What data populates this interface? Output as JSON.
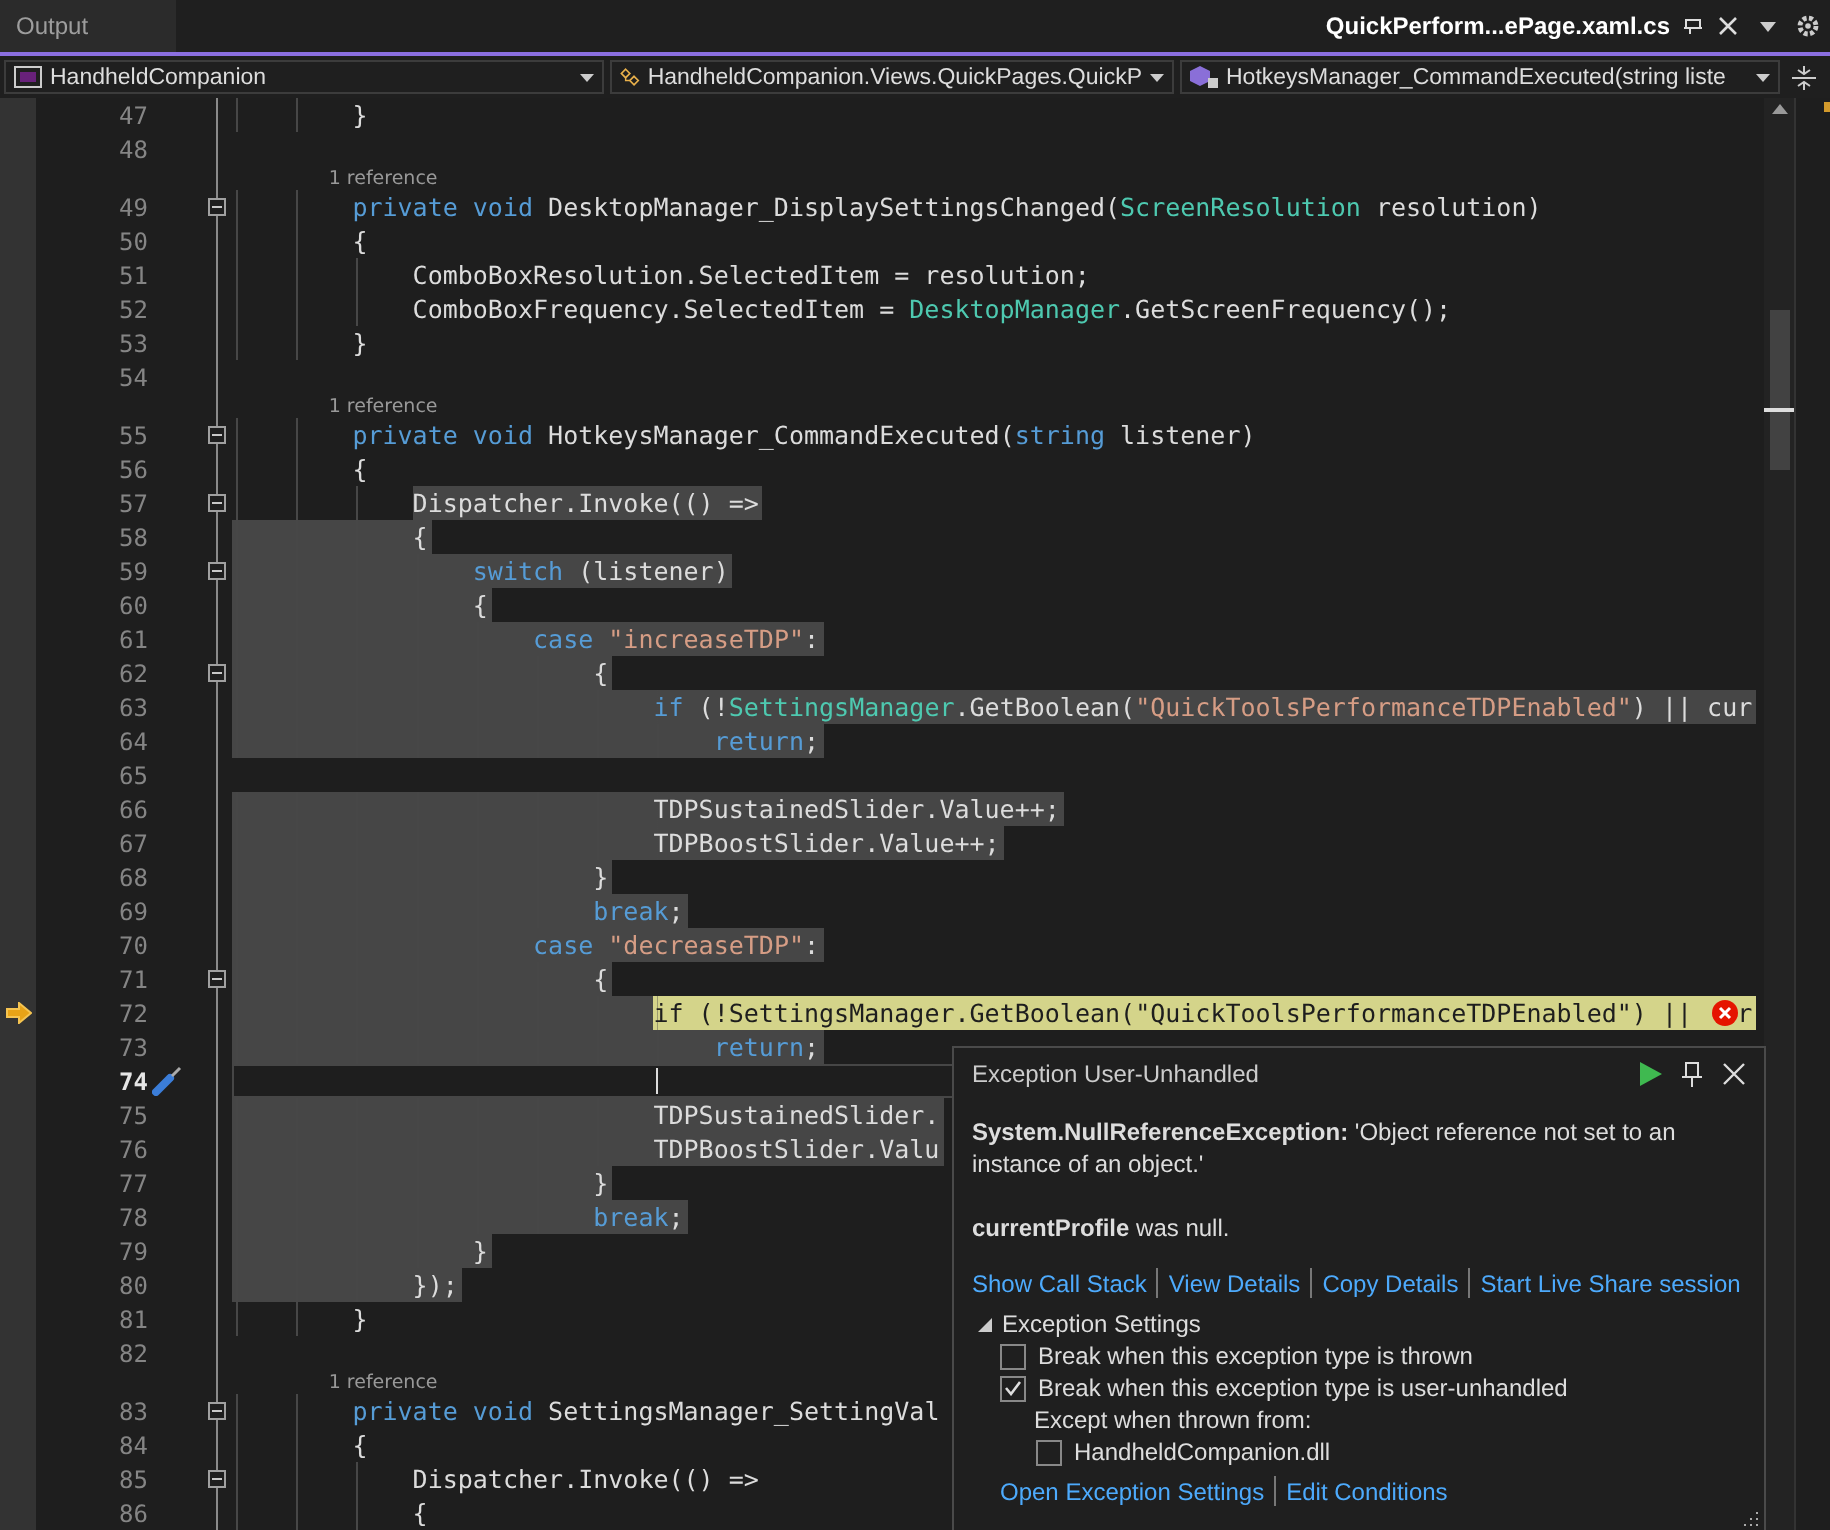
{
  "tabs": [
    {
      "label": "Output",
      "selected": false
    },
    {
      "label": "QuickPerform...ePage.xaml.cs",
      "selected": true
    }
  ],
  "nav": [
    {
      "kind": "project",
      "label": "HandheldCompanion"
    },
    {
      "kind": "class",
      "label": "HandheldCompanion.Views.QuickPages.QuickP"
    },
    {
      "kind": "method",
      "label": "HotkeysManager_CommandExecuted(string liste"
    }
  ],
  "lines": [
    {
      "n": "47",
      "fold": false,
      "highlighted": false,
      "indent_highlighted": false,
      "current": false,
      "cursor": false,
      "tokens": [
        {
          "kind": "id",
          "t": "        }"
        }
      ]
    },
    {
      "n": "48",
      "fold": false,
      "current": false,
      "cursor": false
    },
    {
      "n": "49",
      "lens": "1 reference",
      "fold": true,
      "highlighted": false,
      "indent_highlighted": false,
      "current": false,
      "cursor": false,
      "tokens": [
        {
          "kind": "kw",
          "t": "        private void "
        },
        {
          "kind": "id",
          "t": "DesktopManager_DisplaySettingsChanged("
        },
        {
          "kind": "type",
          "t": "ScreenResolution"
        },
        {
          "kind": "id",
          "t": " resolution)"
        }
      ]
    },
    {
      "n": "50",
      "fold": false,
      "highlighted": false,
      "indent_highlighted": false,
      "current": false,
      "cursor": false,
      "tokens": [
        {
          "kind": "id",
          "t": "        {"
        }
      ]
    },
    {
      "n": "51",
      "fold": false,
      "highlighted": false,
      "indent_highlighted": false,
      "current": false,
      "cursor": false,
      "tokens": [
        {
          "kind": "id",
          "t": "            ComboBoxResolution.SelectedItem = resolution;"
        }
      ]
    },
    {
      "n": "52",
      "fold": false,
      "highlighted": false,
      "indent_highlighted": false,
      "current": false,
      "cursor": false,
      "tokens": [
        {
          "kind": "id",
          "t": "            ComboBoxFrequency.SelectedItem = "
        },
        {
          "kind": "type",
          "t": "DesktopManager"
        },
        {
          "kind": "id",
          "t": ".GetScreenFrequency();"
        }
      ]
    },
    {
      "n": "53",
      "fold": false,
      "highlighted": false,
      "indent_highlighted": false,
      "current": false,
      "cursor": false,
      "tokens": [
        {
          "kind": "id",
          "t": "        }"
        }
      ]
    },
    {
      "n": "54",
      "fold": false,
      "current": false,
      "cursor": false
    },
    {
      "n": "55",
      "lens": "1 reference",
      "fold": true,
      "highlighted": false,
      "indent_highlighted": false,
      "current": false,
      "cursor": false,
      "tokens": [
        {
          "kind": "kw",
          "t": "        private void "
        },
        {
          "kind": "id",
          "t": "HotkeysManager_CommandExecuted("
        },
        {
          "kind": "kw",
          "t": "string"
        },
        {
          "kind": "id",
          "t": " listener)"
        }
      ]
    },
    {
      "n": "56",
      "fold": false,
      "highlighted": false,
      "indent_highlighted": false,
      "current": false,
      "cursor": false,
      "tokens": [
        {
          "kind": "id",
          "t": "        {"
        }
      ]
    },
    {
      "n": "57",
      "fold": true,
      "highlighted": true,
      "indent_highlighted": false,
      "current": false,
      "cursor": false,
      "tokens": [
        {
          "kind": "id",
          "t": "            Dispatcher.Invoke(() =>"
        }
      ]
    },
    {
      "n": "58",
      "fold": false,
      "highlighted": true,
      "indent_highlighted": true,
      "current": false,
      "cursor": false,
      "tokens": [
        {
          "kind": "id",
          "t": "            {"
        }
      ]
    },
    {
      "n": "59",
      "fold": true,
      "highlighted": true,
      "indent_highlighted": true,
      "current": false,
      "cursor": false,
      "tokens": [
        {
          "kind": "kw",
          "t": "                switch"
        },
        {
          "kind": "id",
          "t": " (listener)"
        }
      ]
    },
    {
      "n": "60",
      "fold": false,
      "highlighted": true,
      "indent_highlighted": true,
      "current": false,
      "cursor": false,
      "tokens": [
        {
          "kind": "id",
          "t": "                {"
        }
      ]
    },
    {
      "n": "61",
      "fold": false,
      "highlighted": true,
      "indent_highlighted": true,
      "current": false,
      "cursor": false,
      "tokens": [
        {
          "kind": "kw",
          "t": "                    case "
        },
        {
          "kind": "str",
          "t": "\"increaseTDP\""
        },
        {
          "kind": "id",
          "t": ":"
        }
      ]
    },
    {
      "n": "62",
      "fold": true,
      "highlighted": true,
      "indent_highlighted": true,
      "current": false,
      "cursor": false,
      "tokens": [
        {
          "kind": "id",
          "t": "                        {"
        }
      ]
    },
    {
      "n": "63",
      "fold": false,
      "highlighted": true,
      "indent_highlighted": true,
      "current": false,
      "cursor": false,
      "tokens": [
        {
          "kind": "kw",
          "t": "                            if"
        },
        {
          "kind": "id",
          "t": " (!"
        },
        {
          "kind": "type",
          "t": "SettingsManager"
        },
        {
          "kind": "id",
          "t": ".GetBoolean("
        },
        {
          "kind": "str",
          "t": "\"QuickToolsPerformanceTDPEnabled\""
        },
        {
          "kind": "id",
          "t": ") || cur"
        }
      ]
    },
    {
      "n": "64",
      "fold": false,
      "highlighted": true,
      "indent_highlighted": true,
      "current": false,
      "cursor": false,
      "tokens": [
        {
          "kind": "kw",
          "t": "                                return"
        },
        {
          "kind": "id",
          "t": ";"
        }
      ]
    },
    {
      "n": "65",
      "fold": false,
      "current": false,
      "cursor": false
    },
    {
      "n": "66",
      "fold": false,
      "highlighted": true,
      "indent_highlighted": true,
      "current": false,
      "cursor": false,
      "tokens": [
        {
          "kind": "id",
          "t": "                            TDPSustainedSlider.Value++;"
        }
      ]
    },
    {
      "n": "67",
      "fold": false,
      "highlighted": true,
      "indent_highlighted": true,
      "current": false,
      "cursor": false,
      "tokens": [
        {
          "kind": "id",
          "t": "                            TDPBoostSlider.Value++;"
        }
      ]
    },
    {
      "n": "68",
      "fold": false,
      "highlighted": true,
      "indent_highlighted": true,
      "current": false,
      "cursor": false,
      "tokens": [
        {
          "kind": "id",
          "t": "                        }"
        }
      ]
    },
    {
      "n": "69",
      "fold": false,
      "highlighted": true,
      "indent_highlighted": true,
      "current": false,
      "cursor": false,
      "tokens": [
        {
          "kind": "kw",
          "t": "                        break"
        },
        {
          "kind": "id",
          "t": ";"
        }
      ]
    },
    {
      "n": "70",
      "fold": false,
      "highlighted": true,
      "indent_highlighted": true,
      "current": false,
      "cursor": false,
      "tokens": [
        {
          "kind": "kw",
          "t": "                    case "
        },
        {
          "kind": "str",
          "t": "\"decreaseTDP\""
        },
        {
          "kind": "id",
          "t": ":"
        }
      ]
    },
    {
      "n": "71",
      "fold": true,
      "highlighted": true,
      "indent_highlighted": true,
      "current": false,
      "cursor": false,
      "tokens": [
        {
          "kind": "id",
          "t": "                        {"
        }
      ]
    },
    {
      "n": "72",
      "fold": false,
      "indent_highlighted": true,
      "current": true,
      "cursor": false,
      "tokens": [
        {
          "kind": "kw",
          "t": "                            if"
        },
        {
          "kind": "id",
          "t": " (!"
        },
        {
          "kind": "type",
          "t": "SettingsManager"
        },
        {
          "kind": "id",
          "t": ".GetBoolean("
        },
        {
          "kind": "str",
          "t": "\"QuickToolsPerformanceTDPEnabled\""
        },
        {
          "kind": "id",
          "t": ") || "
        },
        {
          "kind": "error"
        },
        {
          "kind": "id",
          "t": "r"
        }
      ]
    },
    {
      "n": "73",
      "fold": false,
      "highlighted": true,
      "indent_highlighted": true,
      "current": false,
      "cursor": false,
      "tokens": [
        {
          "kind": "kw",
          "t": "                                return"
        },
        {
          "kind": "id",
          "t": ";"
        }
      ]
    },
    {
      "n": "74",
      "fold": false,
      "current": false,
      "cursor": true
    },
    {
      "n": "75",
      "fold": false,
      "highlighted": true,
      "indent_highlighted": true,
      "current": false,
      "cursor": false,
      "tokens": [
        {
          "kind": "id",
          "t": "                            TDPSustainedSlider."
        }
      ]
    },
    {
      "n": "76",
      "fold": false,
      "highlighted": true,
      "indent_highlighted": true,
      "current": false,
      "cursor": false,
      "tokens": [
        {
          "kind": "id",
          "t": "                            TDPBoostSlider.Valu"
        }
      ]
    },
    {
      "n": "77",
      "fold": false,
      "highlighted": true,
      "indent_highlighted": true,
      "current": false,
      "cursor": false,
      "tokens": [
        {
          "kind": "id",
          "t": "                        }"
        }
      ]
    },
    {
      "n": "78",
      "fold": false,
      "highlighted": true,
      "indent_highlighted": true,
      "current": false,
      "cursor": false,
      "tokens": [
        {
          "kind": "kw",
          "t": "                        break"
        },
        {
          "kind": "id",
          "t": ";"
        }
      ]
    },
    {
      "n": "79",
      "fold": false,
      "highlighted": true,
      "indent_highlighted": true,
      "current": false,
      "cursor": false,
      "tokens": [
        {
          "kind": "id",
          "t": "                }"
        }
      ]
    },
    {
      "n": "80",
      "fold": false,
      "highlighted": true,
      "indent_highlighted": true,
      "current": false,
      "cursor": false,
      "tokens": [
        {
          "kind": "id",
          "t": "            });"
        }
      ]
    },
    {
      "n": "81",
      "fold": false,
      "highlighted": false,
      "indent_highlighted": false,
      "current": false,
      "cursor": false,
      "tokens": [
        {
          "kind": "id",
          "t": "        }"
        }
      ]
    },
    {
      "n": "82",
      "fold": false,
      "current": false,
      "cursor": false
    },
    {
      "n": "83",
      "lens": "1 reference",
      "fold": true,
      "highlighted": false,
      "indent_highlighted": false,
      "current": false,
      "cursor": false,
      "tokens": [
        {
          "kind": "kw",
          "t": "        private void "
        },
        {
          "kind": "id",
          "t": "SettingsManager_SettingVal"
        }
      ]
    },
    {
      "n": "84",
      "fold": false,
      "highlighted": false,
      "indent_highlighted": false,
      "current": false,
      "cursor": false,
      "tokens": [
        {
          "kind": "id",
          "t": "        {"
        }
      ]
    },
    {
      "n": "85",
      "fold": true,
      "highlighted": false,
      "indent_highlighted": false,
      "current": false,
      "cursor": false,
      "tokens": [
        {
          "kind": "id",
          "t": "            Dispatcher.Invoke(() =>"
        }
      ]
    },
    {
      "n": "86",
      "fold": false,
      "highlighted": false,
      "indent_highlighted": false,
      "current": false,
      "cursor": false,
      "tokens": [
        {
          "kind": "id",
          "t": "            {"
        }
      ]
    }
  ],
  "exception": {
    "title": "Exception User-Unhandled",
    "message": "**System.NullReferenceException:** 'Object reference not set to an instance of an object.'",
    "detail": "**currentProfile** was null.",
    "links": [
      "Show Call Stack",
      "View Details",
      "Copy Details",
      "Start Live Share session"
    ],
    "settings": {
      "label": "Exception Settings",
      "expanded": true,
      "options": [
        {
          "label": "Break when this exception type is thrown",
          "checked": false
        },
        {
          "label": "Break when this exception type is user-unhandled",
          "checked": true
        }
      ],
      "except_label": "Except when thrown from:",
      "modules": [
        {
          "label": "HandheldCompanion.dll",
          "checked": false
        }
      ]
    },
    "footer_links": [
      "Open Exception Settings",
      "Edit Conditions"
    ]
  }
}
